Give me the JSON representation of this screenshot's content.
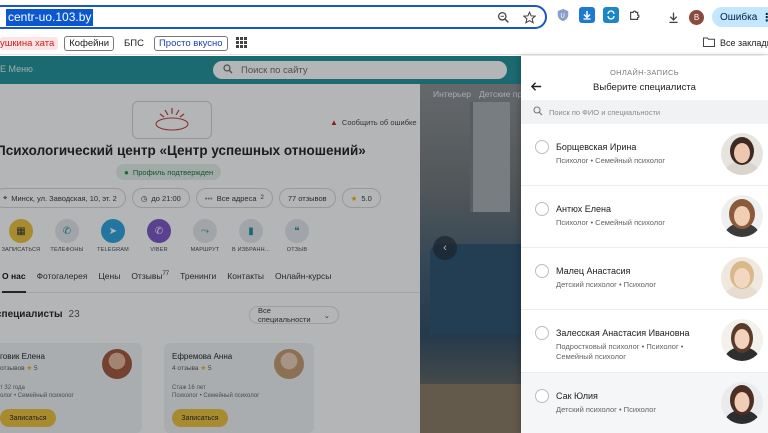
{
  "browser": {
    "url": "centr-uo.103.by",
    "error_label": "Ошибка",
    "avatar_letter": "B",
    "bookmarks": [
      "ушкина хата",
      "Кофейни",
      "БПС",
      "Просто вкусно"
    ],
    "all_bookmarks_label": "Все закладк"
  },
  "site": {
    "menu_label": "Е Меню",
    "search_placeholder": "Поиск по сайту",
    "report_error": "Сообщить об ошибке",
    "photo_tabs": [
      "Интерьер",
      "Детские про"
    ],
    "title": "Психологический центр «Центр успешных отношений»",
    "verified": "Профиль подтвержден",
    "chips": {
      "address": "Минск, ул. Заводская, 10, эт. 2",
      "hours": "до 21:00",
      "all_addresses": "Все адреса",
      "all_addresses_count": "2",
      "reviews": "77 отзывов",
      "rating": "5.0"
    },
    "actions": [
      "ЗАПИСАТЬСЯ",
      "ТЕЛЕФОНЫ",
      "TELEGRAM",
      "VIBER",
      "МАРШРУТ",
      "В ИЗБРАНН...",
      "ОТЗЫВ"
    ],
    "tabs": [
      "О нас",
      "Фотогалерея",
      "Цены",
      "Отзывы",
      "Тренинги",
      "Контакты",
      "Онлайн-курсы"
    ],
    "reviews_tab_count": "77",
    "specialists_heading": "специалисты",
    "specialists_count": "23",
    "all_specialists": "Все специальности",
    "mini_cards": [
      {
        "name": "говик Елена",
        "reviews": "отзывов",
        "rating": "5",
        "experience": "т 32 года",
        "profession": "олог • Семейный психолог",
        "button": "Записаться"
      },
      {
        "name": "Ефремова Анна",
        "reviews": "4 отзыва",
        "rating": "5",
        "experience": "Стаж 16 лет",
        "profession": "Психолог • Семейный психолог",
        "button": "Записаться"
      }
    ]
  },
  "panel": {
    "overline": "ОНЛАЙН-ЗАПИСЬ",
    "title": "Выберите специалиста",
    "search_placeholder": "Поиск по ФИО и специальности",
    "specialists": [
      {
        "name": "Борщевская Ирина",
        "spec": "Психолог • Семейный психолог"
      },
      {
        "name": "Антюх Елена",
        "spec": "Психолог • Семейный психолог"
      },
      {
        "name": "Малец Анастасия",
        "spec": "Детский психолог • Психолог"
      },
      {
        "name": "Залесская Анастасия Ивановна",
        "spec": "Подростковый психолог • Психолог • Семейный психолог"
      },
      {
        "name": "Сак Юлия",
        "spec": "Детский психолог • Психолог"
      }
    ]
  },
  "colors": {
    "accent_blue": "#1a56c4",
    "site_teal": "#1f8f9a",
    "cta_yellow": "#f0c238"
  }
}
